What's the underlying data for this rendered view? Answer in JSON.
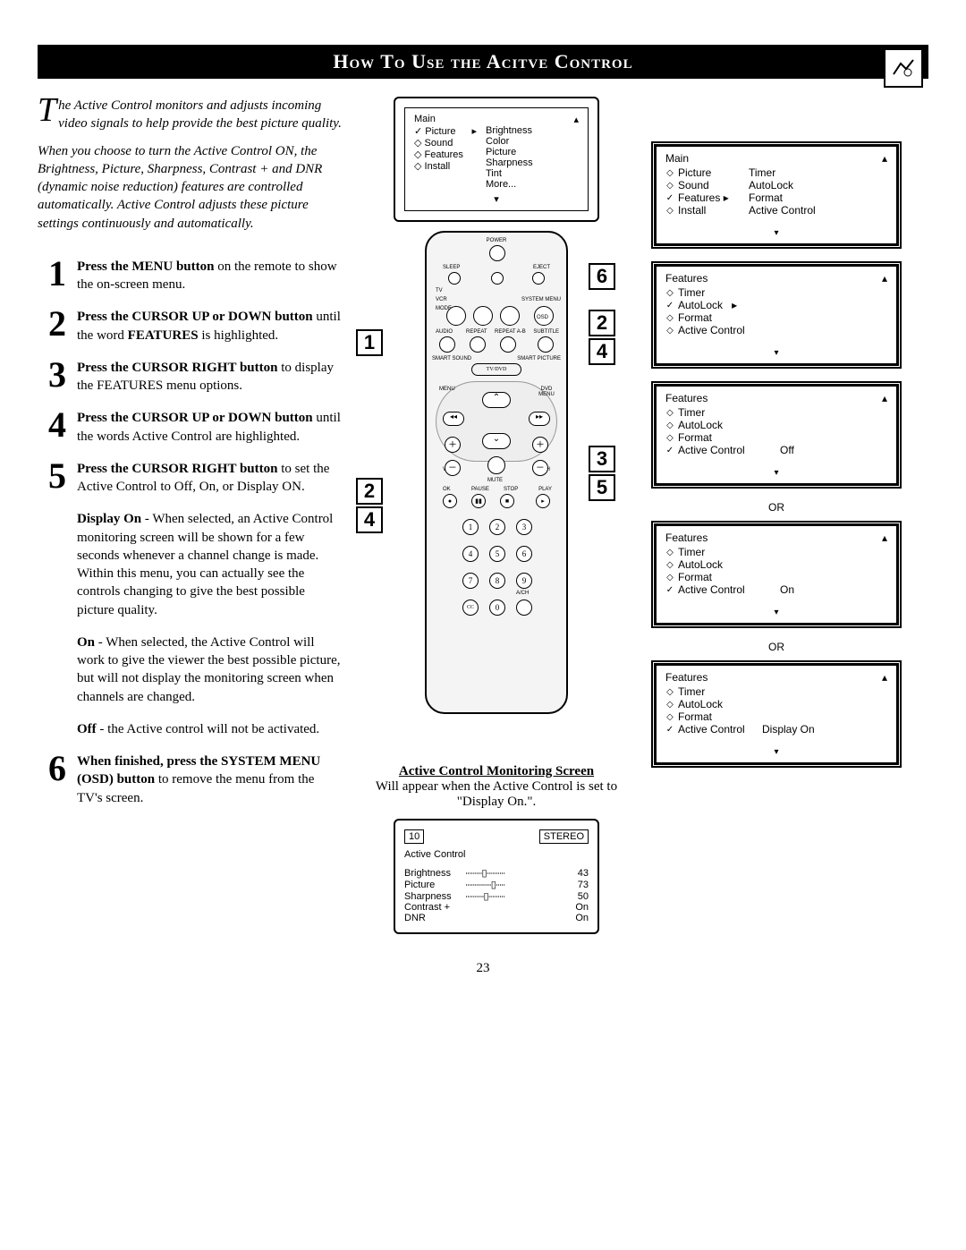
{
  "title": "How To Use the Acitve Control",
  "pageNumber": "23",
  "intro1": "he Active Control monitors and adjusts incoming video signals to help provide the best picture quality.",
  "intro2": "When you choose to turn the Active Control ON, the Brightness, Picture, Sharpness, Contrast + and DNR (dynamic noise reduction) features are controlled automatically. Active Control adjusts these picture settings continuously and automatically.",
  "steps": [
    {
      "n": "1",
      "bold": "Press the MENU button",
      "rest": " on the remote to show the on-screen menu."
    },
    {
      "n": "2",
      "bold": "Press the CURSOR UP or DOWN button",
      "rest": " until the word ",
      "bold2": "FEATURES",
      "rest2": " is highlighted."
    },
    {
      "n": "3",
      "bold": "Press the CURSOR RIGHT button",
      "rest": " to display the FEATURES menu options."
    },
    {
      "n": "4",
      "bold": "Press the CURSOR UP or DOWN button",
      "rest": " until the words Active Control are highlighted."
    },
    {
      "n": "5",
      "bold": "Press the CURSOR RIGHT button",
      "rest": " to set the Active Control to Off, On, or Display ON."
    }
  ],
  "subDisplayOn": {
    "b": "Display On",
    "rest": " - When selected, an Active Control monitoring screen will be shown for a few seconds whenever a channel change is made. Within this menu, you can actually see the controls changing to give the best possible picture quality."
  },
  "subOn": {
    "b": "On",
    "rest": " - When selected, the Active Control will work to give the viewer the best possible picture, but will not display the monitoring screen when channels are changed."
  },
  "subOff": {
    "b": "Off",
    "rest": " - the Active control will not be activated."
  },
  "step6": {
    "n": "6",
    "bold": "When finished, press the SYSTEM MENU (OSD) button",
    "rest": " to remove the menu from the TV's screen."
  },
  "screen1": {
    "head": "Main",
    "left": [
      "✓ Picture",
      "◇ Sound",
      "◇ Features",
      "◇ Install"
    ],
    "right": [
      "Brightness",
      "Color",
      "Picture",
      "Sharpness",
      "Tint",
      "More..."
    ]
  },
  "osdMain": {
    "head": "Main",
    "rows": [
      {
        "d": "◇",
        "l": "Picture",
        "v": "Timer"
      },
      {
        "d": "◇",
        "l": "Sound",
        "v": "AutoLock"
      },
      {
        "d": "✓",
        "l": "Features",
        "v": "Format",
        "arrow": "▸"
      },
      {
        "d": "◇",
        "l": "Install",
        "v": "Active Control"
      }
    ]
  },
  "osdFeat1": {
    "head": "Features",
    "rows": [
      {
        "d": "◇",
        "l": "Timer"
      },
      {
        "d": "✓",
        "l": "AutoLock",
        "arrow": "▸"
      },
      {
        "d": "◇",
        "l": "Format"
      },
      {
        "d": "◇",
        "l": "Active Control"
      }
    ]
  },
  "osdFeatOff": {
    "head": "Features",
    "rows": [
      {
        "d": "◇",
        "l": "Timer"
      },
      {
        "d": "◇",
        "l": "AutoLock"
      },
      {
        "d": "◇",
        "l": "Format"
      },
      {
        "d": "✓",
        "l": "Active Control",
        "v": "Off"
      }
    ]
  },
  "osdFeatOn": {
    "head": "Features",
    "rows": [
      {
        "d": "◇",
        "l": "Timer"
      },
      {
        "d": "◇",
        "l": "AutoLock"
      },
      {
        "d": "◇",
        "l": "Format"
      },
      {
        "d": "✓",
        "l": "Active Control",
        "v": "On"
      }
    ]
  },
  "osdFeatDisp": {
    "head": "Features",
    "rows": [
      {
        "d": "◇",
        "l": "Timer"
      },
      {
        "d": "◇",
        "l": "AutoLock"
      },
      {
        "d": "◇",
        "l": "Format"
      },
      {
        "d": "✓",
        "l": "Active Control",
        "v": "Display On"
      }
    ]
  },
  "or": "OR",
  "monLabel1": "Active Control Monitoring Screen",
  "monLabel2": "Will appear when the Active Control is set to \"Display On.\".",
  "monScreen": {
    "ch": "10",
    "mode": "STEREO",
    "title": "Active Control",
    "rows": [
      {
        "l": "Brightness",
        "v": "43"
      },
      {
        "l": "Picture",
        "v": "73"
      },
      {
        "l": "Sharpness",
        "v": "50"
      },
      {
        "l": "Contrast +",
        "v": "On"
      },
      {
        "l": "DNR",
        "v": "On"
      }
    ]
  },
  "callouts": {
    "l1": "1",
    "l2a": "2",
    "l2b": "4",
    "r6": "6",
    "r2a": "2",
    "r2b": "4",
    "r3": "3",
    "r5": "5"
  },
  "remote": {
    "power": "POWER",
    "sleep": "SLEEP",
    "eject": "EJECT",
    "tv": "TV",
    "vcr": "VCR",
    "mode": "MODE",
    "system": "SYSTEM MENU",
    "osd": "OSD",
    "audio": "AUDIO",
    "repeat": "REPEAT",
    "repeatab": "REPEAT A-B",
    "subtitle": "SUBTITLE",
    "smartsound": "SMART SOUND",
    "smartpic": "SMART PICTURE",
    "tvdvd": "TV/DVD",
    "menu": "MENU",
    "dvdmenu": "DVD MENU",
    "vol": "VOL",
    "ch": "CH",
    "mute": "MUTE",
    "ok": "OK",
    "pause": "PAUSE",
    "stop": "STOP",
    "play": "PLAY",
    "cc": "CC",
    "ach": "A/CH"
  }
}
